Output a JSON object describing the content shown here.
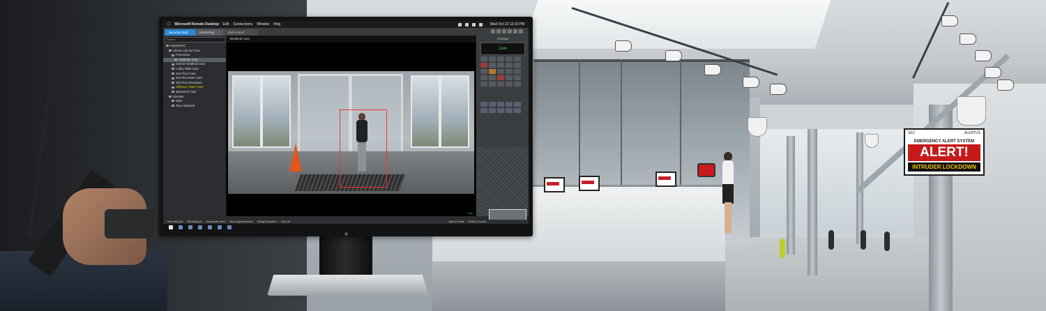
{
  "menubar": {
    "app_name": "Microsoft Remote Desktop",
    "items": [
      "Edit",
      "Connections",
      "Window",
      "Help"
    ],
    "datetime": "Wed Oct 12  12:10 PM"
  },
  "tabs": [
    {
      "label": "Security Desk"
    },
    {
      "label": "Monitoring"
    },
    {
      "label": "Alarm report"
    }
  ],
  "tree": {
    "search_placeholder": "Search",
    "items": [
      {
        "label": "HQ035TEC",
        "state": "normal"
      },
      {
        "label": "Alertus HQ 1st Floor",
        "state": "normal"
      },
      {
        "label": "Front Door",
        "state": "normal"
      },
      {
        "label": "Vestibule Cam",
        "state": "selected"
      },
      {
        "label": "Interior Vestibule Door",
        "state": "normal"
      },
      {
        "label": "Lobby Wide Cam",
        "state": "normal"
      },
      {
        "label": "2nd Floor Cam",
        "state": "normal"
      },
      {
        "label": "3rd Floor Rear Cam",
        "state": "normal"
      },
      {
        "label": "3rd Floor Reception",
        "state": "normal"
      },
      {
        "label": "AlPhone Tower Cam",
        "state": "highlighted"
      },
      {
        "label": "Basement Cam",
        "state": "normal"
      },
      {
        "label": "Elevator",
        "state": "normal"
      },
      {
        "label": "Main",
        "state": "normal"
      },
      {
        "label": "Rear Stairwell",
        "state": "normal"
      }
    ]
  },
  "video": {
    "title": "Vestibule Cam",
    "live_tag": "Live"
  },
  "controls": {
    "title": "Camera",
    "live_label": "Live"
  },
  "bottom_toolbar": {
    "items": [
      "Hide area view",
      "Monitoring (2)",
      "Synchronize video",
      "Show original streams",
      "Change tile pattern",
      "Clear all"
    ],
    "right_items": [
      "Open the Vault",
      "Switch to monitor"
    ]
  },
  "alert_sign": {
    "left_logo": "SEC",
    "right_logo": "ALERTUS",
    "system_label": "EMERGENCY ALERT SYSTEM",
    "headline": "ALERT!",
    "message": "INTRUDER LOCKDOWN"
  },
  "colors": {
    "accent_tab": "#2c8ad8",
    "alert_red": "#c61a1a",
    "lockdown_yellow": "#f2c400",
    "live_green": "#49d449"
  }
}
